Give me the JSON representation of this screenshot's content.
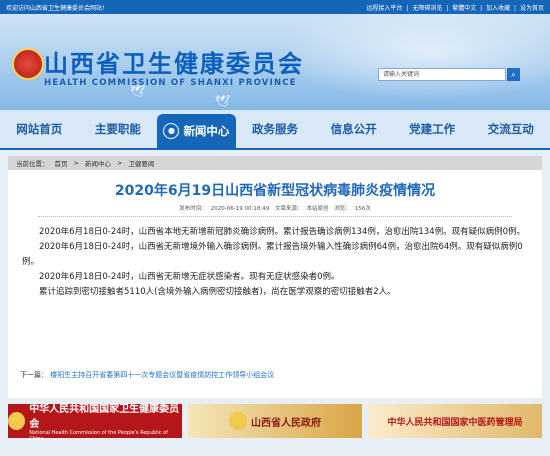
{
  "topbar": {
    "welcome": "欢迎访问山西省卫生健康委员会网站！",
    "links": [
      "远程接入平台",
      "|",
      "无障碍浏览",
      "|",
      "繁體中文",
      "|",
      "加入收藏",
      "|",
      "设为首页"
    ]
  },
  "header": {
    "title_cn": "山西省卫生健康委员会",
    "title_en": "HEALTH COMMISSION OF SHANXI PROVINCE",
    "search_placeholder": "请输入关键词",
    "search_icon": "search-icon"
  },
  "nav": {
    "items": [
      "网站首页",
      "主要职能",
      "新闻中心",
      "政务服务",
      "信息公开",
      "党建工作",
      "交流互动"
    ],
    "active_index": 2
  },
  "breadcrumb": {
    "label": "当前位置：",
    "items": [
      "首页",
      ">",
      "新闻中心",
      ">",
      "卫健要闻"
    ]
  },
  "article": {
    "title": "2020年6月19日山西省新型冠状病毒肺炎疫情情况",
    "meta": {
      "publish_label": "发布时间：",
      "publish_time": "2020-06-19 00:18:49",
      "source_label": "文章来源：",
      "source": "本站原创",
      "views_label": "浏览：",
      "views": "156次"
    },
    "paragraphs": [
      "2020年6月18日0-24时，山西省本地无新增新冠肺炎确诊病例。累计报告确诊病例134例，治愈出院134例。现有疑似病例0例。",
      "2020年6月18日0-24时，山西省无新增境外输入确诊病例。累计报告境外输入性确诊病例64例，治愈出院64例。现有疑似病例0例。",
      "2020年6月18日0-24时，山西省无新增无症状感染者。现有无症状感染者0例。",
      "累计追踪到密切接触者5110人(含境外输入病例密切接触者)，尚在医学观察的密切接触者2人。"
    ],
    "next_label": "下一篇：",
    "next_link": "楼阳生主持召开省委第四十一次专题会议暨省疫情防控工作领导小组会议"
  },
  "footer_logos": [
    {
      "title": "中华人民共和国国家卫生健康委员会",
      "sub": "National Health Commission of the People's Republic of China"
    },
    {
      "title": "山西省人民政府"
    },
    {
      "title": "中华人民共和国国家中医药管理局"
    }
  ],
  "colors": {
    "brand_blue": "#1565b8",
    "title_blue": "#2369b9",
    "footer_red": "#b5161a"
  }
}
